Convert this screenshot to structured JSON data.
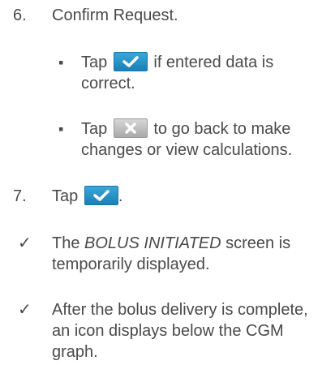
{
  "step6": {
    "number": "6.",
    "text": "Confirm Request.",
    "bullet1": {
      "marker": "▪",
      "pre": "Tap",
      "post": "if entered data is",
      "line2": "correct."
    },
    "bullet2": {
      "marker": "▪",
      "pre": "Tap",
      "post": "to go back to make",
      "line2": "changes or view calculations."
    }
  },
  "step7": {
    "number": "7.",
    "pre": "Tap",
    "post": "."
  },
  "result1": {
    "marker": "✓",
    "pre": "The",
    "emph": "BOLUS INITIATED",
    "post": "screen is",
    "line2": "temporarily displayed."
  },
  "result2": {
    "marker": "✓",
    "line1": "After the bolus delivery is complete,",
    "line2": "an icon displays below the CGM",
    "line3": "graph."
  },
  "icons": {
    "confirm": "check-icon",
    "cancel": "x-icon"
  },
  "colors": {
    "text": "#4a4a4a",
    "confirm_button": "#2a93c9",
    "cancel_button": "#bdbdbd"
  }
}
